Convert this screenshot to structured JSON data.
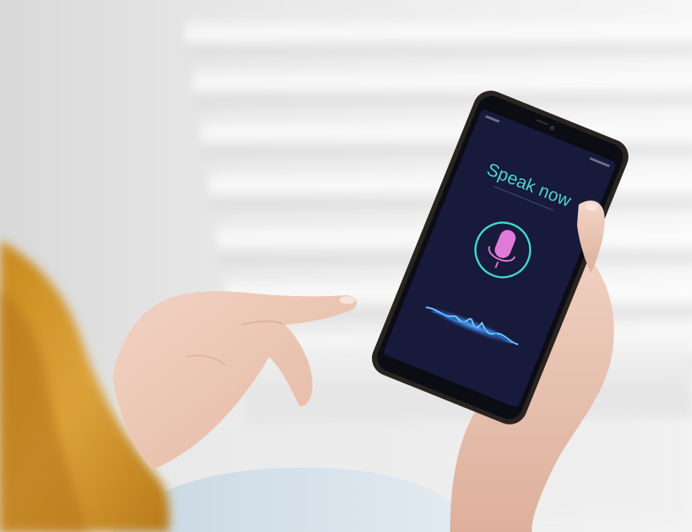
{
  "phone_screen": {
    "prompt_text": "Speak now",
    "microphone_icon": "microphone-icon",
    "waveform_icon": "voice-waveform-icon"
  },
  "colors": {
    "screen_background": "#171a3a",
    "prompt_teal": "#4fd2d2",
    "mic_pink": "#e07ad8",
    "ring_teal": "#3fd8cf",
    "wave_blue": "#4fa6ff",
    "sweater_mustard": "#d39a2c",
    "wall_light": "#ececec"
  }
}
